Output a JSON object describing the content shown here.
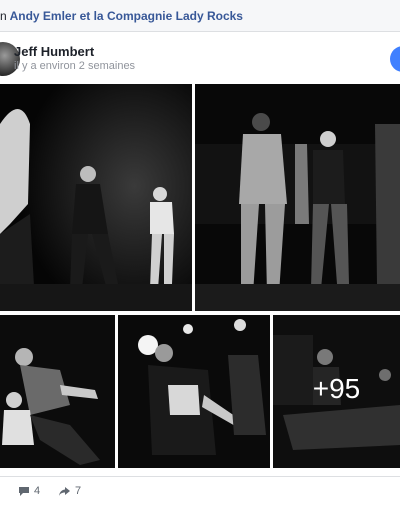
{
  "header": {
    "lead": "n",
    "group_link": "Andy Emler et la Compagnie Lady Rocks"
  },
  "post": {
    "author": "Jeff Humbert",
    "timestamp": "il y a environ 2 semaines",
    "more_photos": "+95",
    "stats": {
      "reactions": "4",
      "comments": "4",
      "shares": "7"
    }
  },
  "colors": {
    "link": "#385898",
    "accent": "#4080ff",
    "muted": "#90949c"
  },
  "icons": {
    "comment": "comment-icon",
    "share": "share-icon"
  }
}
